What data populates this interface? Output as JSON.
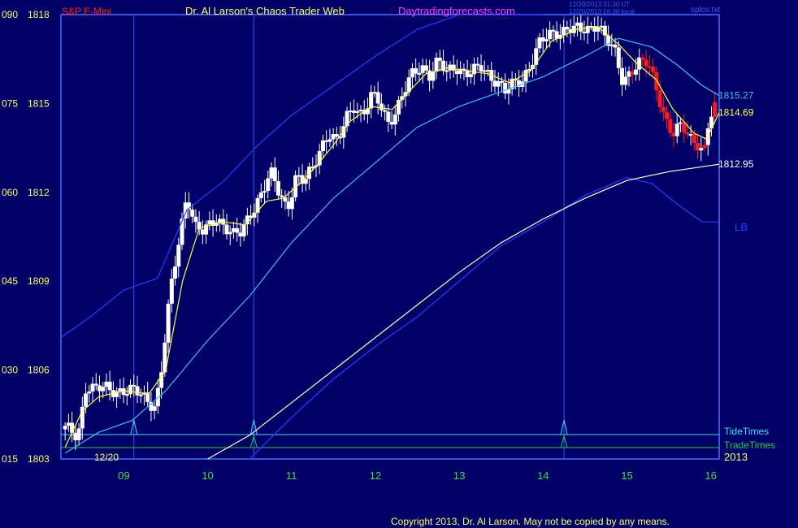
{
  "header": {
    "symbol": "S&P E-Mini",
    "title": "Dr. Al Larson's Chaos Trader Web",
    "site": "Daytradingforecasts.com",
    "stamp1": "12/20/2013 21:30 UT",
    "stamp2": "12/20/2013 16:30 local",
    "file": "splcs.txt"
  },
  "footer": {
    "copyright": "Copyright 2013, Dr. Al Larson. May not be copied by any means.",
    "date_marker": "12/20",
    "year": "2013"
  },
  "labels": {
    "tide_times": "TideTimes",
    "trade_times": "TradeTimes",
    "lb": "LB"
  },
  "colors": {
    "background": "#000066",
    "axis": "#4a6cff",
    "title_red": "#ff2020",
    "title_yellow": "#ffff66",
    "site_magenta": "#ff40ff",
    "x_labels": "#44dd44",
    "tide_cyan": "#44ddff",
    "trade_green": "#22cc44",
    "up_bar": "#ffffff",
    "down_bar": "#ff1a1a",
    "ma_fast": "#ffff44",
    "ma_cyan": "#44bbee",
    "band_blue": "#2a3cff",
    "ma_slow": "#ffffcc"
  },
  "chart_data": {
    "type": "candlestick",
    "ylim": [
      1803,
      1818
    ],
    "y_ticks": [
      {
        "value": 1818,
        "left": "090",
        "right": "1818"
      },
      {
        "value": 1815,
        "left": "075",
        "right": "1815"
      },
      {
        "value": 1812,
        "left": "060",
        "right": "1812"
      },
      {
        "value": 1809,
        "left": "045",
        "right": "1809"
      },
      {
        "value": 1806,
        "left": "030",
        "right": "1806"
      },
      {
        "value": 1803,
        "left": "015",
        "right": "1803"
      }
    ],
    "xlim": [
      8.25,
      16.1
    ],
    "x_ticks": [
      9,
      10,
      11,
      12,
      13,
      14,
      15,
      16
    ],
    "x_tick_labels": [
      "09",
      "10",
      "11",
      "12",
      "13",
      "14",
      "15",
      "16"
    ],
    "value_labels": [
      {
        "value": 1815.27,
        "text": "1815.27",
        "series": "ma_cyan"
      },
      {
        "value": 1814.69,
        "text": "1814.69",
        "series": "ma_fast"
      },
      {
        "value": 1812.95,
        "text": "1812.95",
        "series": "ma_slow"
      }
    ],
    "tide_times": [
      9.12,
      10.55,
      14.25
    ],
    "trade_times": [
      10.55,
      14.25
    ],
    "price_path": [
      [
        8.3,
        1804.0
      ],
      [
        8.45,
        1803.8
      ],
      [
        8.55,
        1805.5
      ],
      [
        8.65,
        1805.3
      ],
      [
        8.8,
        1805.4
      ],
      [
        9.0,
        1805.3
      ],
      [
        9.2,
        1805.2
      ],
      [
        9.38,
        1804.8
      ],
      [
        9.45,
        1806.0
      ],
      [
        9.55,
        1808.5
      ],
      [
        9.65,
        1810.3
      ],
      [
        9.75,
        1812.0
      ],
      [
        9.85,
        1810.8
      ],
      [
        9.95,
        1810.6
      ],
      [
        10.1,
        1811.2
      ],
      [
        10.2,
        1810.9
      ],
      [
        10.3,
        1810.5
      ],
      [
        10.4,
        1810.6
      ],
      [
        10.5,
        1811.3
      ],
      [
        10.65,
        1812.0
      ],
      [
        10.75,
        1812.6
      ],
      [
        10.85,
        1812.0
      ],
      [
        10.95,
        1811.5
      ],
      [
        11.05,
        1812.5
      ],
      [
        11.15,
        1812.3
      ],
      [
        11.25,
        1812.8
      ],
      [
        11.35,
        1813.6
      ],
      [
        11.45,
        1814.0
      ],
      [
        11.55,
        1813.6
      ],
      [
        11.65,
        1814.5
      ],
      [
        11.75,
        1815.0
      ],
      [
        11.85,
        1814.6
      ],
      [
        11.95,
        1815.2
      ],
      [
        12.05,
        1815.0
      ],
      [
        12.15,
        1814.4
      ],
      [
        12.25,
        1814.8
      ],
      [
        12.35,
        1815.4
      ],
      [
        12.45,
        1816.0
      ],
      [
        12.55,
        1816.3
      ],
      [
        12.65,
        1816.0
      ],
      [
        12.75,
        1816.4
      ],
      [
        12.85,
        1816.0
      ],
      [
        12.95,
        1816.3
      ],
      [
        13.05,
        1816.1
      ],
      [
        13.15,
        1816.0
      ],
      [
        13.25,
        1816.2
      ],
      [
        13.35,
        1816.0
      ],
      [
        13.45,
        1815.8
      ],
      [
        13.55,
        1815.4
      ],
      [
        13.65,
        1815.6
      ],
      [
        13.75,
        1815.8
      ],
      [
        13.85,
        1816.4
      ],
      [
        13.95,
        1817.0
      ],
      [
        14.05,
        1817.2
      ],
      [
        14.15,
        1817.4
      ],
      [
        14.3,
        1817.6
      ],
      [
        14.45,
        1817.4
      ],
      [
        14.55,
        1817.5
      ],
      [
        14.65,
        1817.8
      ],
      [
        14.75,
        1817.2
      ],
      [
        14.85,
        1816.7
      ],
      [
        14.95,
        1815.7
      ],
      [
        15.05,
        1816.2
      ],
      [
        15.15,
        1816.4
      ],
      [
        15.25,
        1816.3
      ],
      [
        15.35,
        1815.5
      ],
      [
        15.45,
        1814.6
      ],
      [
        15.55,
        1814.0
      ],
      [
        15.65,
        1814.2
      ],
      [
        15.75,
        1813.8
      ],
      [
        15.85,
        1813.7
      ],
      [
        15.92,
        1813.4
      ],
      [
        15.98,
        1814.5
      ],
      [
        16.05,
        1814.8
      ],
      [
        16.1,
        1814.6
      ]
    ],
    "red_from": 14.95,
    "series": [
      {
        "name": "ma_fast",
        "values": [
          [
            8.3,
            1803.4
          ],
          [
            8.5,
            1804.6
          ],
          [
            8.7,
            1805.1
          ],
          [
            9.0,
            1805.3
          ],
          [
            9.3,
            1805.2
          ],
          [
            9.5,
            1806.0
          ],
          [
            9.7,
            1809.0
          ],
          [
            9.9,
            1810.8
          ],
          [
            10.2,
            1811.0
          ],
          [
            10.45,
            1810.9
          ],
          [
            10.7,
            1811.7
          ],
          [
            10.9,
            1811.8
          ],
          [
            11.1,
            1812.3
          ],
          [
            11.3,
            1812.9
          ],
          [
            11.5,
            1813.6
          ],
          [
            11.7,
            1814.4
          ],
          [
            11.95,
            1814.9
          ],
          [
            12.2,
            1814.8
          ],
          [
            12.4,
            1815.4
          ],
          [
            12.6,
            1816.0
          ],
          [
            12.85,
            1816.2
          ],
          [
            13.1,
            1816.1
          ],
          [
            13.35,
            1816.0
          ],
          [
            13.6,
            1815.7
          ],
          [
            13.85,
            1816.1
          ],
          [
            14.1,
            1817.1
          ],
          [
            14.4,
            1817.5
          ],
          [
            14.65,
            1817.6
          ],
          [
            14.9,
            1817.0
          ],
          [
            15.1,
            1816.4
          ],
          [
            15.35,
            1815.8
          ],
          [
            15.55,
            1814.8
          ],
          [
            15.8,
            1814.0
          ],
          [
            15.95,
            1813.8
          ],
          [
            16.1,
            1814.69
          ]
        ]
      },
      {
        "name": "ma_cyan",
        "values": [
          [
            8.3,
            1803.2
          ],
          [
            8.7,
            1803.9
          ],
          [
            9.1,
            1804.3
          ],
          [
            9.5,
            1805.3
          ],
          [
            10.0,
            1807.0
          ],
          [
            10.5,
            1808.5
          ],
          [
            11.0,
            1810.3
          ],
          [
            11.5,
            1811.8
          ],
          [
            12.0,
            1813.0
          ],
          [
            12.5,
            1814.2
          ],
          [
            13.0,
            1814.9
          ],
          [
            13.5,
            1815.4
          ],
          [
            14.0,
            1815.9
          ],
          [
            14.5,
            1816.6
          ],
          [
            14.9,
            1817.2
          ],
          [
            15.3,
            1816.9
          ],
          [
            15.6,
            1816.3
          ],
          [
            15.9,
            1815.6
          ],
          [
            16.1,
            1815.27
          ]
        ]
      },
      {
        "name": "band_upper",
        "values": [
          [
            8.25,
            1807.1
          ],
          [
            8.6,
            1807.8
          ],
          [
            9.0,
            1808.7
          ],
          [
            9.4,
            1809.1
          ],
          [
            9.75,
            1811.4
          ],
          [
            10.2,
            1812.4
          ],
          [
            10.6,
            1813.6
          ],
          [
            11.0,
            1814.6
          ],
          [
            11.5,
            1815.6
          ],
          [
            12.0,
            1816.6
          ],
          [
            12.5,
            1817.5
          ],
          [
            13.0,
            1818.2
          ],
          [
            13.5,
            1818.8
          ],
          [
            14.0,
            1819.4
          ]
        ]
      },
      {
        "name": "band_lower",
        "values": [
          [
            10.5,
            1803.0
          ],
          [
            11.0,
            1804.4
          ],
          [
            11.5,
            1805.7
          ],
          [
            12.0,
            1806.8
          ],
          [
            12.5,
            1807.8
          ],
          [
            13.0,
            1809.0
          ],
          [
            13.5,
            1810.2
          ],
          [
            14.0,
            1811.0
          ],
          [
            14.5,
            1811.9
          ],
          [
            15.0,
            1812.5
          ],
          [
            15.3,
            1812.3
          ],
          [
            15.6,
            1811.6
          ],
          [
            15.9,
            1811.0
          ],
          [
            16.1,
            1811.0
          ]
        ]
      },
      {
        "name": "ma_slow",
        "values": [
          [
            10.0,
            1803.0
          ],
          [
            10.5,
            1803.8
          ],
          [
            11.0,
            1804.9
          ],
          [
            11.5,
            1806.0
          ],
          [
            12.0,
            1807.1
          ],
          [
            12.5,
            1808.2
          ],
          [
            13.0,
            1809.3
          ],
          [
            13.5,
            1810.3
          ],
          [
            14.0,
            1811.1
          ],
          [
            14.5,
            1811.8
          ],
          [
            15.0,
            1812.4
          ],
          [
            15.5,
            1812.7
          ],
          [
            16.1,
            1812.95
          ]
        ]
      }
    ]
  }
}
